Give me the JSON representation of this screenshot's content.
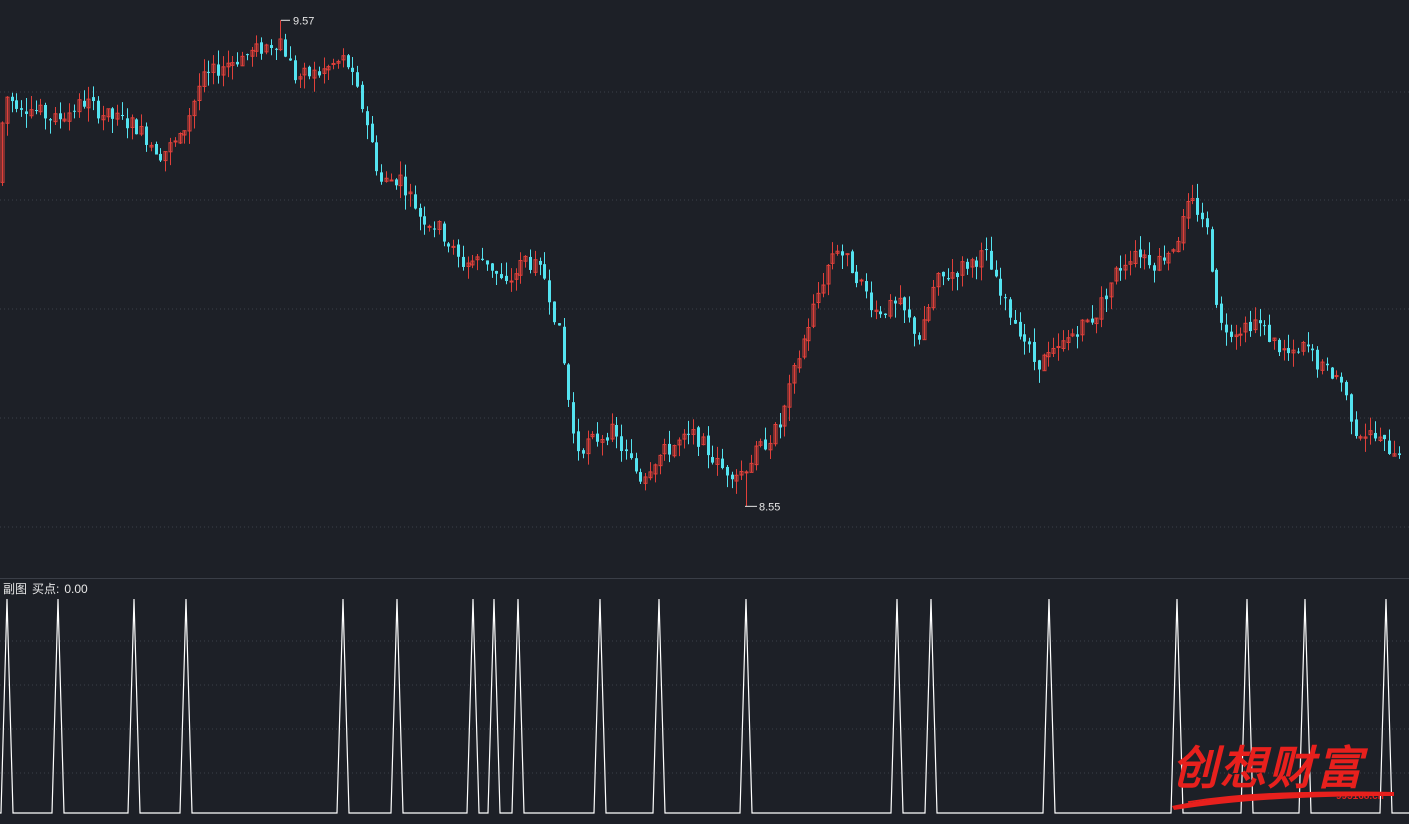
{
  "theme": {
    "background": "#1d2027",
    "grid": "#3b3f48",
    "up_color": "#e0403a",
    "down_color": "#54e3f0",
    "marker_text": "#e6e6e6",
    "signal_line": "#ffffff"
  },
  "main_panel": {
    "high_marker": "9.57",
    "low_marker": "8.55"
  },
  "sub_panel": {
    "name": "副图",
    "indicator_label": "买点:",
    "indicator_value": "0.00"
  },
  "watermark": {
    "text": "创想财富",
    "url": "995168.cn"
  },
  "chart_data": {
    "type": "candlestick",
    "price_min": 8.45,
    "price_max": 9.6,
    "high_value": 9.57,
    "low_value": 8.55,
    "grid": true,
    "candle_keyframes": [
      [
        0,
        9.23
      ],
      [
        10,
        9.41
      ],
      [
        40,
        9.38
      ],
      [
        60,
        9.36
      ],
      [
        90,
        9.4
      ],
      [
        110,
        9.37
      ],
      [
        140,
        9.35
      ],
      [
        165,
        9.29
      ],
      [
        185,
        9.32
      ],
      [
        205,
        9.44
      ],
      [
        230,
        9.48
      ],
      [
        255,
        9.5
      ],
      [
        275,
        9.52
      ],
      [
        285,
        9.53
      ],
      [
        300,
        9.45
      ],
      [
        325,
        9.46
      ],
      [
        350,
        9.49
      ],
      [
        370,
        9.37
      ],
      [
        385,
        9.23
      ],
      [
        405,
        9.24
      ],
      [
        425,
        9.16
      ],
      [
        445,
        9.13
      ],
      [
        465,
        9.06
      ],
      [
        490,
        9.07
      ],
      [
        510,
        9.01
      ],
      [
        530,
        9.07
      ],
      [
        550,
        9.03
      ],
      [
        565,
        8.9
      ],
      [
        580,
        8.67
      ],
      [
        600,
        8.69
      ],
      [
        615,
        8.71
      ],
      [
        645,
        8.61
      ],
      [
        660,
        8.65
      ],
      [
        680,
        8.68
      ],
      [
        700,
        8.7
      ],
      [
        725,
        8.63
      ],
      [
        745,
        8.62
      ],
      [
        760,
        8.66
      ],
      [
        785,
        8.72
      ],
      [
        800,
        8.84
      ],
      [
        820,
        8.98
      ],
      [
        840,
        9.1
      ],
      [
        860,
        9.04
      ],
      [
        880,
        8.96
      ],
      [
        905,
        8.97
      ],
      [
        925,
        8.9
      ],
      [
        940,
        9.02
      ],
      [
        965,
        9.05
      ],
      [
        990,
        9.08
      ],
      [
        1005,
        8.99
      ],
      [
        1025,
        8.92
      ],
      [
        1040,
        8.85
      ],
      [
        1060,
        8.87
      ],
      [
        1080,
        8.92
      ],
      [
        1100,
        8.95
      ],
      [
        1120,
        9.04
      ],
      [
        1140,
        9.09
      ],
      [
        1160,
        9.06
      ],
      [
        1180,
        9.1
      ],
      [
        1195,
        9.19
      ],
      [
        1210,
        9.15
      ],
      [
        1225,
        8.93
      ],
      [
        1240,
        8.92
      ],
      [
        1260,
        8.94
      ],
      [
        1285,
        8.88
      ],
      [
        1300,
        8.86
      ],
      [
        1310,
        8.89
      ],
      [
        1325,
        8.84
      ],
      [
        1345,
        8.82
      ],
      [
        1360,
        8.71
      ],
      [
        1375,
        8.7
      ],
      [
        1395,
        8.67
      ]
    ],
    "buy_signal_x": [
      7,
      58,
      134,
      186,
      343,
      397,
      473,
      494,
      518,
      600,
      659,
      746,
      897,
      931,
      1049,
      1177,
      1247,
      1305,
      1386
    ]
  }
}
